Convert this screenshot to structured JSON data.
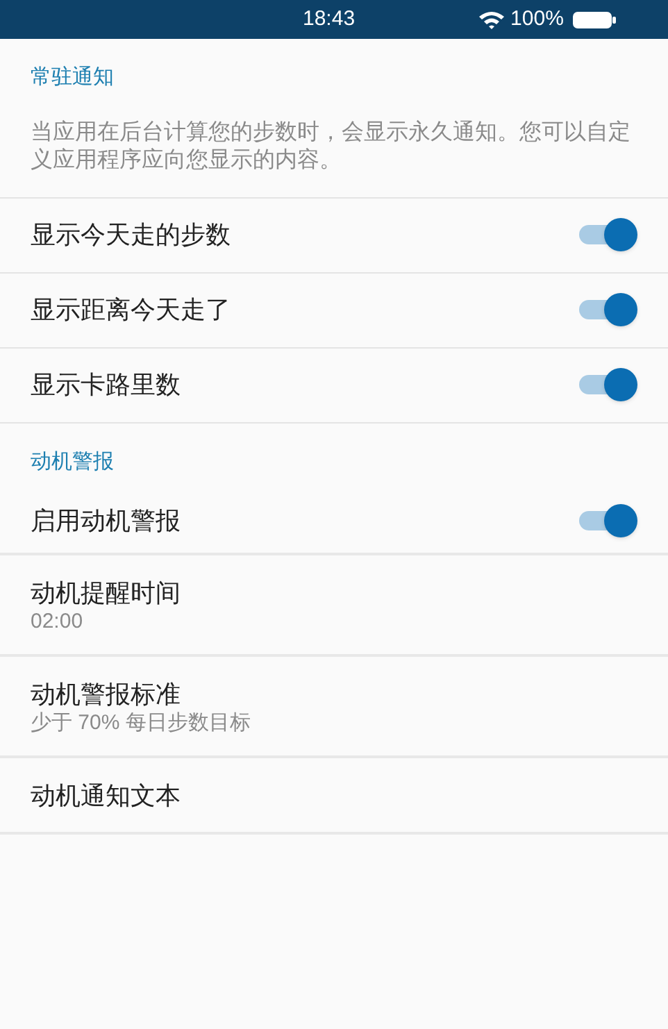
{
  "status_bar": {
    "time": "18:43",
    "battery": "100%"
  },
  "sections": [
    {
      "title": "常驻通知",
      "description": "当应用在后台计算您的步数时，会显示永久通知。您可以自定义应用程序应向您显示的内容。",
      "items": [
        {
          "kind": "toggle",
          "label": "显示今天走的步数",
          "on": true
        },
        {
          "kind": "toggle",
          "label": "显示距离今天走了",
          "on": true
        },
        {
          "kind": "toggle",
          "label": "显示卡路里数",
          "on": true
        }
      ]
    },
    {
      "title": "动机警报",
      "items": [
        {
          "kind": "toggle",
          "label": "启用动机警报",
          "on": true
        },
        {
          "kind": "text",
          "label": "动机提醒时间",
          "summary": "02:00"
        },
        {
          "kind": "text",
          "label": "动机警报标准",
          "summary": "少于 70% 每日步数目标"
        },
        {
          "kind": "text",
          "label": "动机通知文本"
        }
      ]
    }
  ]
}
